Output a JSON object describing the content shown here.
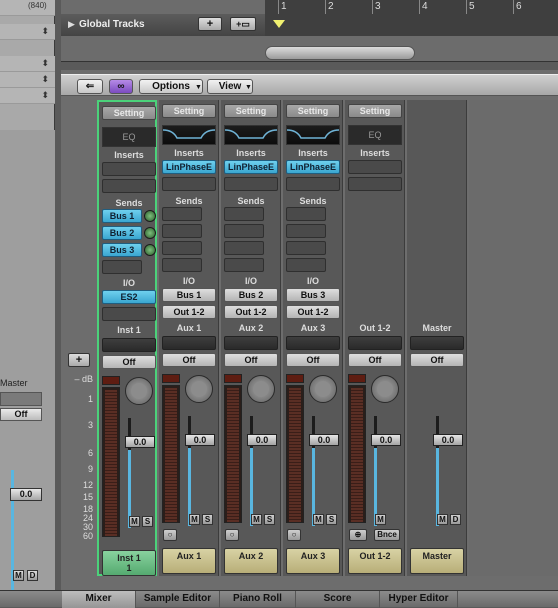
{
  "left_panel": {
    "top_label": "(840)",
    "master_label": "Master",
    "off_label": "Off",
    "fader_value": "0.0",
    "mute_label": "M",
    "dim_label": "D"
  },
  "arrange": {
    "global_tracks_label": "Global Tracks",
    "add_icon": "+",
    "ruler_marks": [
      "1",
      "2",
      "3",
      "4",
      "5",
      "6"
    ]
  },
  "toolbar": {
    "back_icon": "back-arrow-icon",
    "link_icon": "link-icon",
    "options_label": "Options",
    "view_label": "View"
  },
  "db_scale": {
    "header": "– dB",
    "labels": [
      "1",
      "3",
      "6",
      "9",
      "12",
      "15",
      "18",
      "24",
      "30",
      "60"
    ]
  },
  "add_strip_button": "+",
  "strips": [
    {
      "setting": "Setting",
      "eq": "EQ",
      "inserts": "Inserts",
      "insert1": "",
      "sends": "Sends",
      "send_slots": [
        "Bus 1",
        "Bus 2",
        "Bus 3"
      ],
      "io": "I/O",
      "input": "ES2",
      "output": "",
      "name_top": "Inst 1",
      "auto": "Off",
      "fader": "0.0",
      "mute": "M",
      "solo": "S",
      "bottom_name": "Inst 1",
      "bottom_num": "1",
      "selected": true
    },
    {
      "setting": "Setting",
      "eq": "",
      "inserts": "Inserts",
      "insert1": "LinPhaseE",
      "sends": "Sends",
      "send_slots": [
        "",
        "",
        ""
      ],
      "io": "I/O",
      "input": "Bus 1",
      "output": "Out 1-2",
      "name_top": "Aux 1",
      "auto": "Off",
      "fader": "0.0",
      "mute": "M",
      "solo": "S",
      "bottom_name": "Aux 1",
      "bottom_num": "",
      "selected": false
    },
    {
      "setting": "Setting",
      "eq": "",
      "inserts": "Inserts",
      "insert1": "LinPhaseE",
      "sends": "Sends",
      "send_slots": [
        "",
        "",
        ""
      ],
      "io": "I/O",
      "input": "Bus 2",
      "output": "Out 1-2",
      "name_top": "Aux 2",
      "auto": "Off",
      "fader": "0.0",
      "mute": "M",
      "solo": "S",
      "bottom_name": "Aux 2",
      "bottom_num": "",
      "selected": false
    },
    {
      "setting": "Setting",
      "eq": "",
      "inserts": "Inserts",
      "insert1": "LinPhaseE",
      "sends": "Sends",
      "send_slots": [
        "",
        "",
        ""
      ],
      "io": "I/O",
      "input": "Bus 3",
      "output": "Out 1-2",
      "name_top": "Aux 3",
      "auto": "Off",
      "fader": "0.0",
      "mute": "M",
      "solo": "S",
      "bottom_name": "Aux 3",
      "bottom_num": "",
      "selected": false
    },
    {
      "setting": "Setting",
      "eq": "EQ",
      "inserts": "Inserts",
      "insert1": "",
      "sends": "",
      "send_slots": [],
      "io": "",
      "input": "",
      "output": "",
      "name_top": "Out 1-2",
      "auto": "Off",
      "fader": "0.0",
      "mute": "M",
      "solo": "",
      "bounce": "Bnce",
      "bottom_name": "Out 1-2",
      "bottom_num": "",
      "selected": false
    },
    {
      "setting": "",
      "eq": "",
      "inserts": "",
      "insert1": "",
      "sends": "",
      "send_slots": [],
      "io": "",
      "input": "",
      "output": "",
      "name_top": "Master",
      "auto": "Off",
      "fader": "0.0",
      "mute": "M",
      "solo": "D",
      "bottom_name": "Master",
      "bottom_num": "",
      "selected": false
    }
  ],
  "tabs": [
    "Mixer",
    "Sample Editor",
    "Piano Roll",
    "Score",
    "Hyper Editor"
  ],
  "selected_tab": "Mixer",
  "colors": {
    "insert_blue": "#3aa6d0",
    "selected_strip_border": "#4bd27a",
    "name_pill": "#c8be8a",
    "name_pill_selected": "#6cc084",
    "fader_level": "#59b6e0"
  }
}
